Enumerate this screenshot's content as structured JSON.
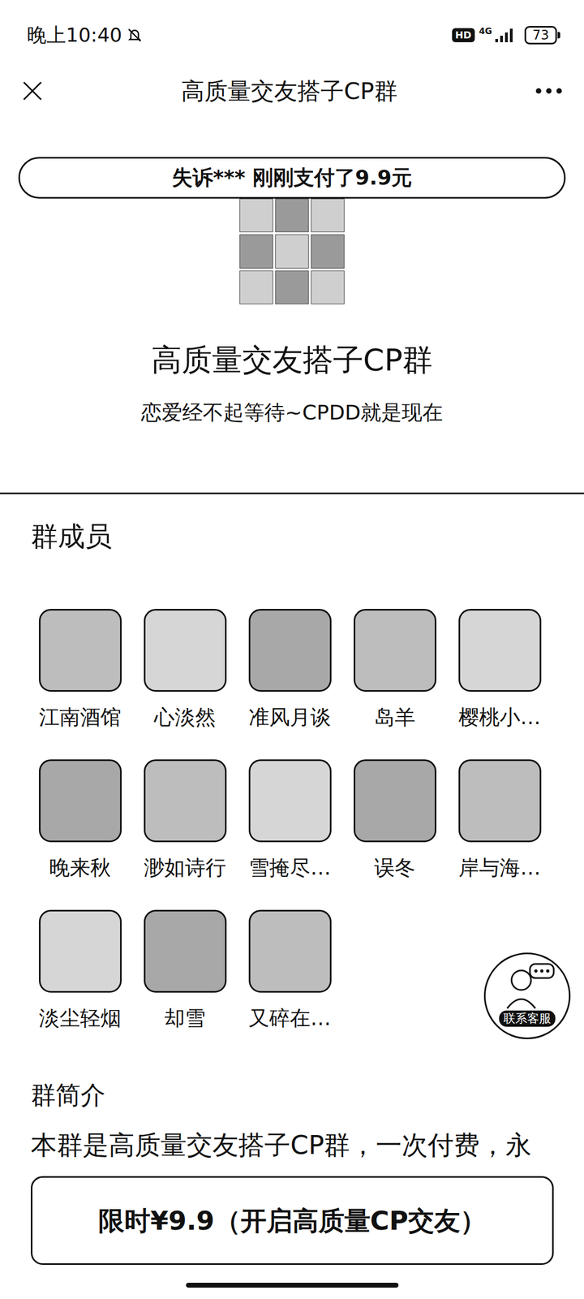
{
  "status_bar": {
    "time": "晚上10:40",
    "hd": "HD",
    "network": "4G",
    "battery": "73"
  },
  "header": {
    "title": "高质量交友搭子CP群"
  },
  "ticker": "失诉*** 刚刚支付了9.9元",
  "group": {
    "name": "高质量交友搭子CP群",
    "slogan": "恋爱经不起等待~CPDD就是现在"
  },
  "members_title": "群成员",
  "members": [
    {
      "name": "江南酒馆"
    },
    {
      "name": "心淡然"
    },
    {
      "name": "准风月谈"
    },
    {
      "name": "岛羊"
    },
    {
      "name": "樱桃小…"
    },
    {
      "name": "晚来秋"
    },
    {
      "name": "渺如诗行"
    },
    {
      "name": "雪掩尽…"
    },
    {
      "name": "误冬"
    },
    {
      "name": "岸与海…"
    },
    {
      "name": "淡尘轻烟"
    },
    {
      "name": "却雪"
    },
    {
      "name": "又碎在…"
    }
  ],
  "intro": {
    "title": "群简介",
    "text": "本群是高质量交友搭子CP群，一次付费，永"
  },
  "support_label": "联系客服",
  "pay_button": "限时¥9.9（开启高质量CP交友）"
}
